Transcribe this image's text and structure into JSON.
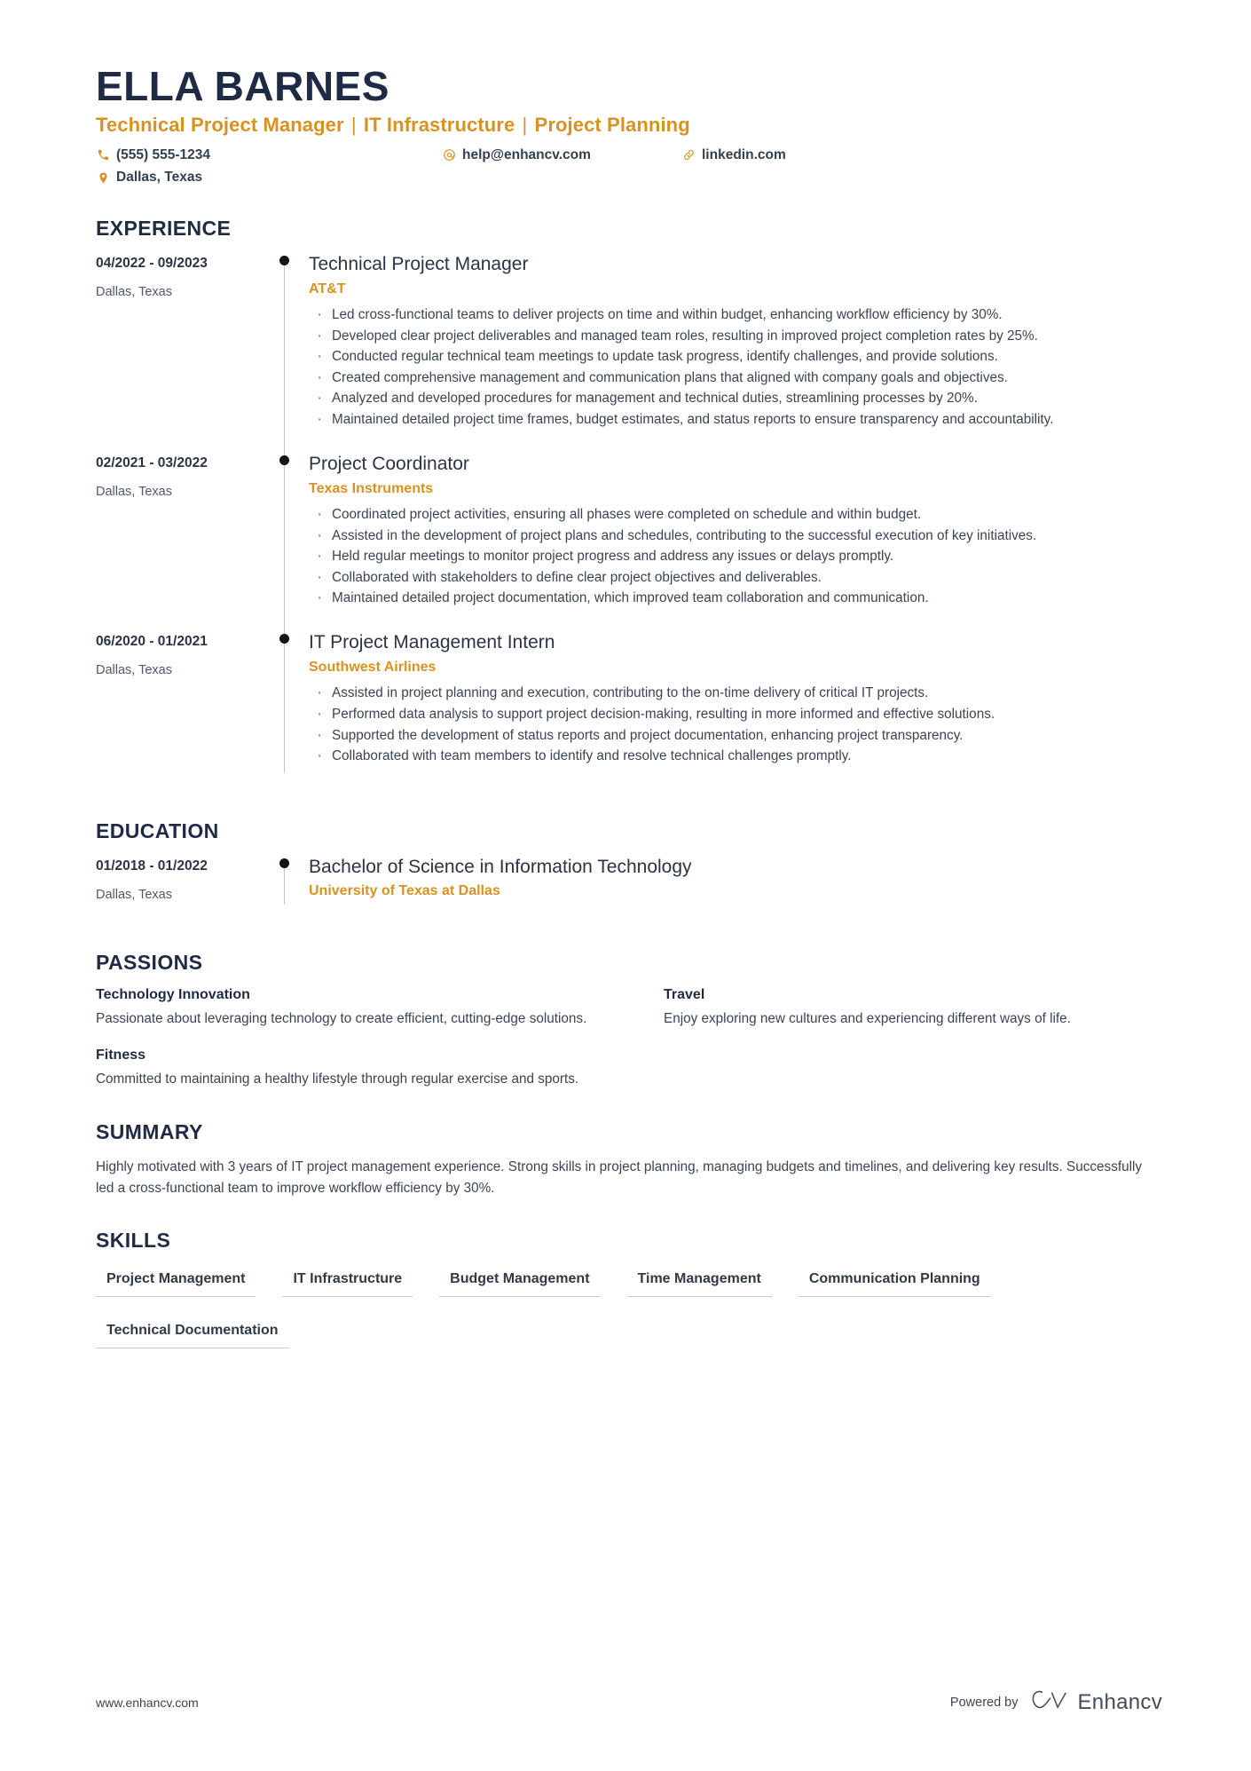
{
  "header": {
    "name": "ELLA BARNES",
    "headline_parts": [
      "Technical Project Manager",
      "IT Infrastructure",
      "Project Planning"
    ],
    "headline": "Technical Project Manager | IT Infrastructure | Project Planning",
    "accent_color": "#d79221",
    "dark_color": "#1f2b44",
    "contacts": [
      {
        "icon": "phone-icon",
        "value": "(555) 555-1234"
      },
      {
        "icon": "email-icon",
        "value": "help@enhancv.com"
      },
      {
        "icon": "link-icon",
        "value": "linkedin.com"
      },
      {
        "icon": "location-icon",
        "value": "Dallas, Texas"
      }
    ]
  },
  "experience": {
    "title": "EXPERIENCE",
    "items": [
      {
        "date": "04/2022 - 09/2023",
        "location": "Dallas, Texas",
        "role": "Technical Project Manager",
        "company": "AT&T",
        "bullets": [
          "Led cross-functional teams to deliver projects on time and within budget, enhancing workflow efficiency by 30%.",
          "Developed clear project deliverables and managed team roles, resulting in improved project completion rates by 25%.",
          "Conducted regular technical team meetings to update task progress, identify challenges, and provide solutions.",
          "Created comprehensive management and communication plans that aligned with company goals and objectives.",
          "Analyzed and developed procedures for management and technical duties, streamlining processes by 20%.",
          "Maintained detailed project time frames, budget estimates, and status reports to ensure transparency and accountability."
        ]
      },
      {
        "date": "02/2021 - 03/2022",
        "location": "Dallas, Texas",
        "role": "Project Coordinator",
        "company": "Texas Instruments",
        "bullets": [
          "Coordinated project activities, ensuring all phases were completed on schedule and within budget.",
          "Assisted in the development of project plans and schedules, contributing to the successful execution of key initiatives.",
          "Held regular meetings to monitor project progress and address any issues or delays promptly.",
          "Collaborated with stakeholders to define clear project objectives and deliverables.",
          "Maintained detailed project documentation, which improved team collaboration and communication."
        ]
      },
      {
        "date": "06/2020 - 01/2021",
        "location": "Dallas, Texas",
        "role": "IT Project Management Intern",
        "company": "Southwest Airlines",
        "bullets": [
          "Assisted in project planning and execution, contributing to the on-time delivery of critical IT projects.",
          "Performed data analysis to support project decision-making, resulting in more informed and effective solutions.",
          "Supported the development of status reports and project documentation, enhancing project transparency.",
          "Collaborated with team members to identify and resolve technical challenges promptly."
        ]
      }
    ]
  },
  "education": {
    "title": "EDUCATION",
    "items": [
      {
        "date": "01/2018 - 01/2022",
        "location": "Dallas, Texas",
        "degree": "Bachelor of Science in Information Technology",
        "school": "University of Texas at Dallas"
      }
    ]
  },
  "passions": {
    "title": "PASSIONS",
    "items": [
      {
        "name": "Technology Innovation",
        "description": "Passionate about leveraging technology to create efficient, cutting-edge solutions."
      },
      {
        "name": "Travel",
        "description": "Enjoy exploring new cultures and experiencing different ways of life."
      },
      {
        "name": "Fitness",
        "description": "Committed to maintaining a healthy lifestyle through regular exercise and sports."
      }
    ]
  },
  "summary": {
    "title": "SUMMARY",
    "text": "Highly motivated with 3 years of IT project management experience. Strong skills in project planning, managing budgets and timelines, and delivering key results. Successfully led a cross-functional team to improve workflow efficiency by 30%."
  },
  "skills": {
    "title": "SKILLS",
    "items": [
      "Project Management",
      "IT Infrastructure",
      "Budget Management",
      "Time Management",
      "Communication Planning",
      "Technical Documentation"
    ]
  },
  "footer": {
    "url": "www.enhancv.com",
    "powered_by": "Powered by",
    "brand": "Enhancv"
  }
}
